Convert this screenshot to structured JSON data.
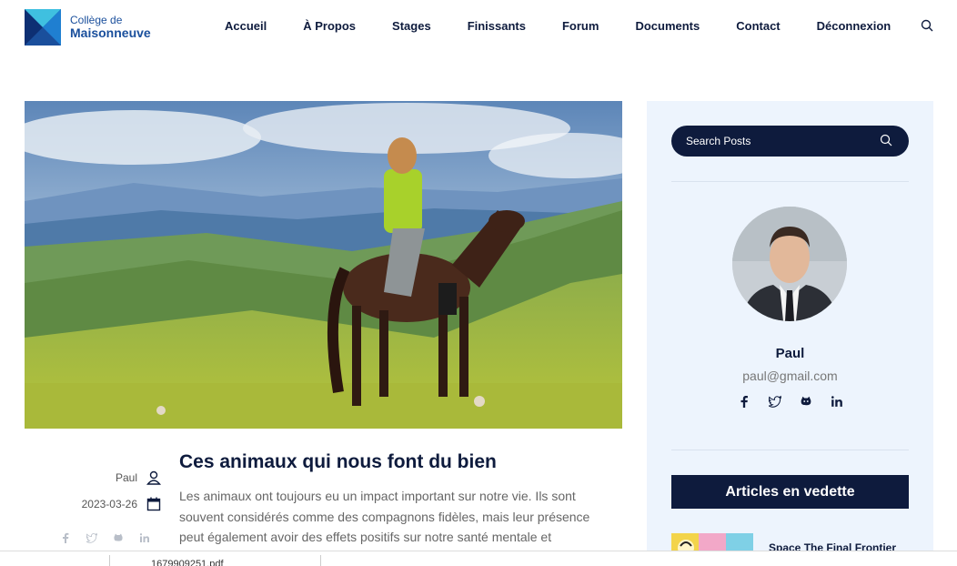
{
  "header": {
    "logo_line1": "Collège de",
    "logo_line2": "Maisonneuve",
    "nav": [
      "Accueil",
      "À Propos",
      "Stages",
      "Finissants",
      "Forum",
      "Documents",
      "Contact",
      "Déconnexion"
    ],
    "search_icon": "search-icon"
  },
  "post": {
    "author": "Paul",
    "date": "2023-03-26",
    "title": "Ces animaux qui nous font du bien",
    "excerpt": "Les animaux ont toujours eu un impact important sur notre vie. Ils sont souvent considérés comme des compagnons fidèles, mais leur présence peut également avoir des effets positifs sur notre santé mentale et",
    "social_icons": [
      "facebook-icon",
      "twitter-icon",
      "github-icon",
      "linkedin-icon"
    ]
  },
  "sidebar": {
    "search_placeholder": "Search Posts",
    "author_name": "Paul",
    "author_email": "paul@gmail.com",
    "featured_heading": "Articles en vedette",
    "featured_first_title": "Space The Final Frontier"
  },
  "bottom_bar": {
    "download_text": "1679909251.pdf"
  },
  "colors": {
    "navy": "#0e1b3d",
    "sidebar_bg": "#edf4fd",
    "logo_blue": "#1a4f9c"
  }
}
